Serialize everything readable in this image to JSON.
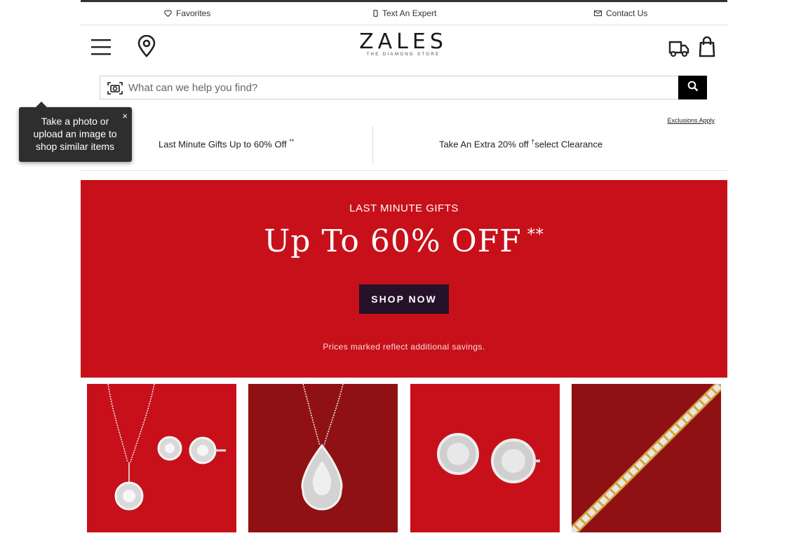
{
  "utility": {
    "favorites": "Favorites",
    "text_expert": "Text An Expert",
    "contact": "Contact Us"
  },
  "logo": {
    "main": "ZALES",
    "tagline": "THE DIAMOND STORE"
  },
  "search": {
    "placeholder": "What can we help you find?"
  },
  "tooltip": {
    "text": "Take a photo or upload an image to shop similar items",
    "close": "×"
  },
  "exclusions": "Exclusions Apply",
  "promos": [
    {
      "text": "Last Minute Gifts Up to 60% Off",
      "mark": "**"
    },
    {
      "text": "Take An Extra 20% off ",
      "mark": "†",
      "suffix": "select Clearance"
    }
  ],
  "hero": {
    "eyebrow": "LAST MINUTE GIFTS",
    "title": "Up To 60% OFF",
    "title_mark": "**",
    "cta": "SHOP NOW",
    "fine_print": "Prices marked reflect additional savings."
  },
  "colors": {
    "hero_red": "#c8101b",
    "dark_red": "#8f1114",
    "cta_bg": "#26112a",
    "gold": "#d4a437"
  },
  "tiles": [
    "necklace-and-earrings-set-image",
    "pear-pendant-image",
    "stud-earrings-image",
    "tennis-bracelet-image"
  ]
}
